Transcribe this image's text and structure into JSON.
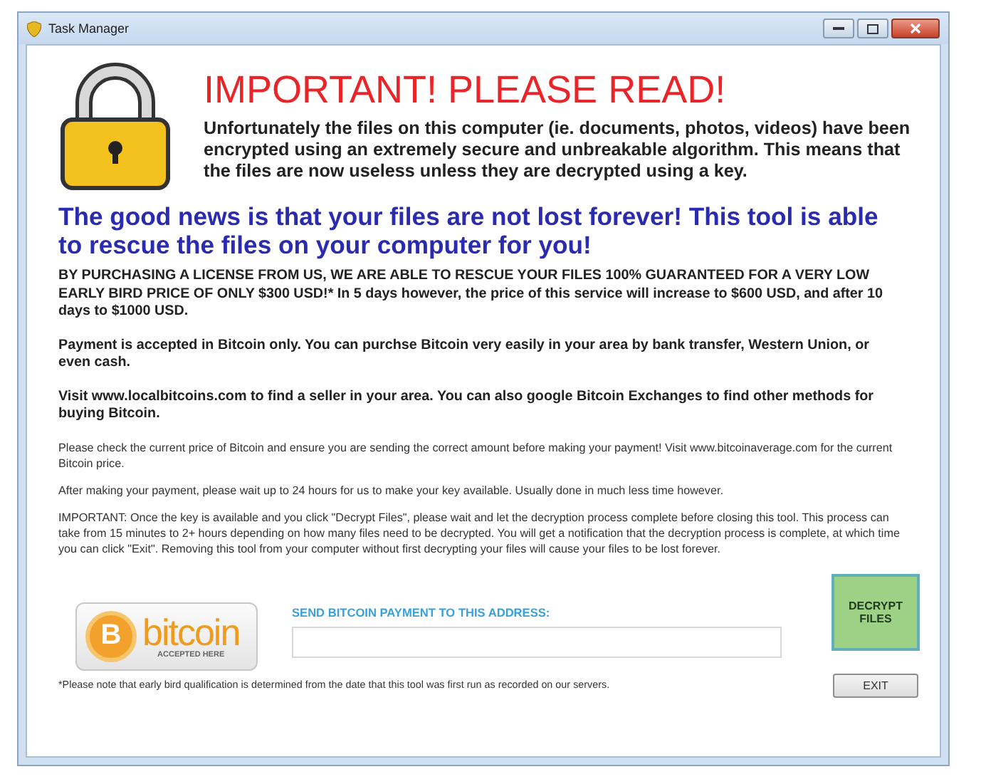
{
  "window": {
    "title": "Task Manager"
  },
  "heading": "IMPORTANT!  PLEASE READ!",
  "intro": "Unfortunately the files on this computer (ie. documents, photos, videos) have been encrypted using an extremely secure and unbreakable algorithm.  This means that the files are now useless unless they are decrypted using a key.",
  "good_news": "The good news is that your files are not lost forever!  This tool is able to rescue the files on your computer for you!",
  "bold_paragraphs": [
    "BY PURCHASING A LICENSE FROM US, WE ARE ABLE TO RESCUE YOUR FILES 100% GUARANTEED FOR A VERY LOW EARLY BIRD PRICE OF ONLY $300 USD!*  In 5 days however, the price of this service will increase to $600 USD, and after 10 days to $1000 USD.",
    "Payment is accepted in Bitcoin only.  You can purchse Bitcoin very easily in your area by bank transfer, Western Union, or even cash.",
    "Visit www.localbitcoins.com to find a seller in your area.  You can also google Bitcoin Exchanges to find other methods for buying Bitcoin."
  ],
  "small_paragraphs": [
    "Please check the current price of Bitcoin and ensure you are sending the correct amount before making your payment!  Visit www.bitcoinaverage.com for the current Bitcoin price.",
    "After making your payment, please wait up to 24 hours for us to make your key available.  Usually done in much less time however.",
    "IMPORTANT:  Once the key is available and you click \"Decrypt Files\", please wait and let the decryption process complete before closing this tool.  This process can take from 15 minutes to 2+ hours depending on how many files need to be decrypted.  You will get a notification that the decryption process is complete, at which time you can click \"Exit\".   Removing this tool from your computer without first decrypting your files will cause your files to be lost forever."
  ],
  "bitcoin_badge": {
    "symbol": "B",
    "word": "bitcoin",
    "caption": "ACCEPTED HERE"
  },
  "address": {
    "label": "SEND BITCOIN PAYMENT TO THIS ADDRESS:"
  },
  "buttons": {
    "decrypt": "DECRYPT FILES",
    "exit": "EXIT"
  },
  "footnote": "*Please note that early bird qualification is determined from the date that this tool was first run as recorded on our servers."
}
